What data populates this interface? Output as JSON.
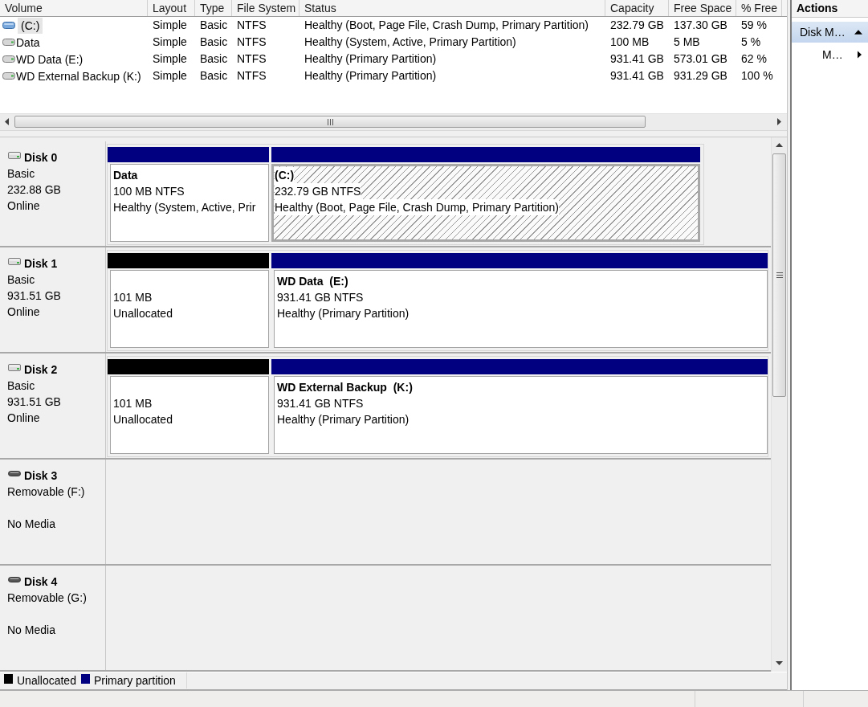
{
  "volume_list": {
    "columns": [
      "Volume",
      "Layout",
      "Type",
      "File System",
      "Status",
      "Capacity",
      "Free Space",
      "% Free"
    ],
    "rows": [
      {
        "selected": true,
        "cells": [
          "(C:)",
          "Simple",
          "Basic",
          "NTFS",
          "Healthy (Boot, Page File, Crash Dump, Primary Partition)",
          "232.79 GB",
          "137.30 GB",
          "59 %"
        ]
      },
      {
        "selected": false,
        "cells": [
          "Data",
          "Simple",
          "Basic",
          "NTFS",
          "Healthy (System, Active, Primary Partition)",
          "100 MB",
          "5 MB",
          "5 %"
        ]
      },
      {
        "selected": false,
        "cells": [
          "WD Data (E:)",
          "Simple",
          "Basic",
          "NTFS",
          "Healthy (Primary Partition)",
          "931.41 GB",
          "573.01 GB",
          "62 %"
        ]
      },
      {
        "selected": false,
        "cells": [
          "WD External Backup (K:)",
          "Simple",
          "Basic",
          "NTFS",
          "Healthy (Primary Partition)",
          "931.41 GB",
          "931.29 GB",
          "100 %"
        ]
      }
    ]
  },
  "disks": [
    {
      "kind": "basic",
      "name": "Disk 0",
      "type": "Basic",
      "size": "232.88 GB",
      "status": "Online",
      "partitions": [
        {
          "kind": "primary",
          "selected": false,
          "name": "Data",
          "size": "100 MB NTFS",
          "status": "Healthy (System, Active, Prir"
        },
        {
          "kind": "primary",
          "selected": true,
          "name": "(C:)",
          "size": "232.79 GB NTFS",
          "status": "Healthy (Boot, Page File, Crash Dump, Primary Partition)"
        }
      ]
    },
    {
      "kind": "basic",
      "name": "Disk 1",
      "type": "Basic",
      "size": "931.51 GB",
      "status": "Online",
      "partitions": [
        {
          "kind": "unallocated",
          "selected": false,
          "size": "101 MB",
          "status": "Unallocated"
        },
        {
          "kind": "primary",
          "selected": false,
          "name": "WD Data  (E:)",
          "size": "931.41 GB NTFS",
          "status": "Healthy (Primary Partition)"
        }
      ]
    },
    {
      "kind": "basic",
      "name": "Disk 2",
      "type": "Basic",
      "size": "931.51 GB",
      "status": "Online",
      "partitions": [
        {
          "kind": "unallocated",
          "selected": false,
          "size": "101 MB",
          "status": "Unallocated"
        },
        {
          "kind": "primary",
          "selected": false,
          "name": "WD External Backup  (K:)",
          "size": "931.41 GB NTFS",
          "status": "Healthy (Primary Partition)"
        }
      ]
    },
    {
      "kind": "removable",
      "name": "Disk 3",
      "type": "Removable (F:)",
      "status": "No Media"
    },
    {
      "kind": "removable",
      "name": "Disk 4",
      "type": "Removable (G:)",
      "status": "No Media"
    }
  ],
  "legend": [
    {
      "label": "Unallocated",
      "color": "#000000"
    },
    {
      "label": "Primary partition",
      "color": "#000080"
    }
  ],
  "actions": {
    "title": "Actions",
    "sections": [
      {
        "label": "Disk M…",
        "expanded": true,
        "items": [
          {
            "label": "M…"
          }
        ]
      }
    ]
  }
}
